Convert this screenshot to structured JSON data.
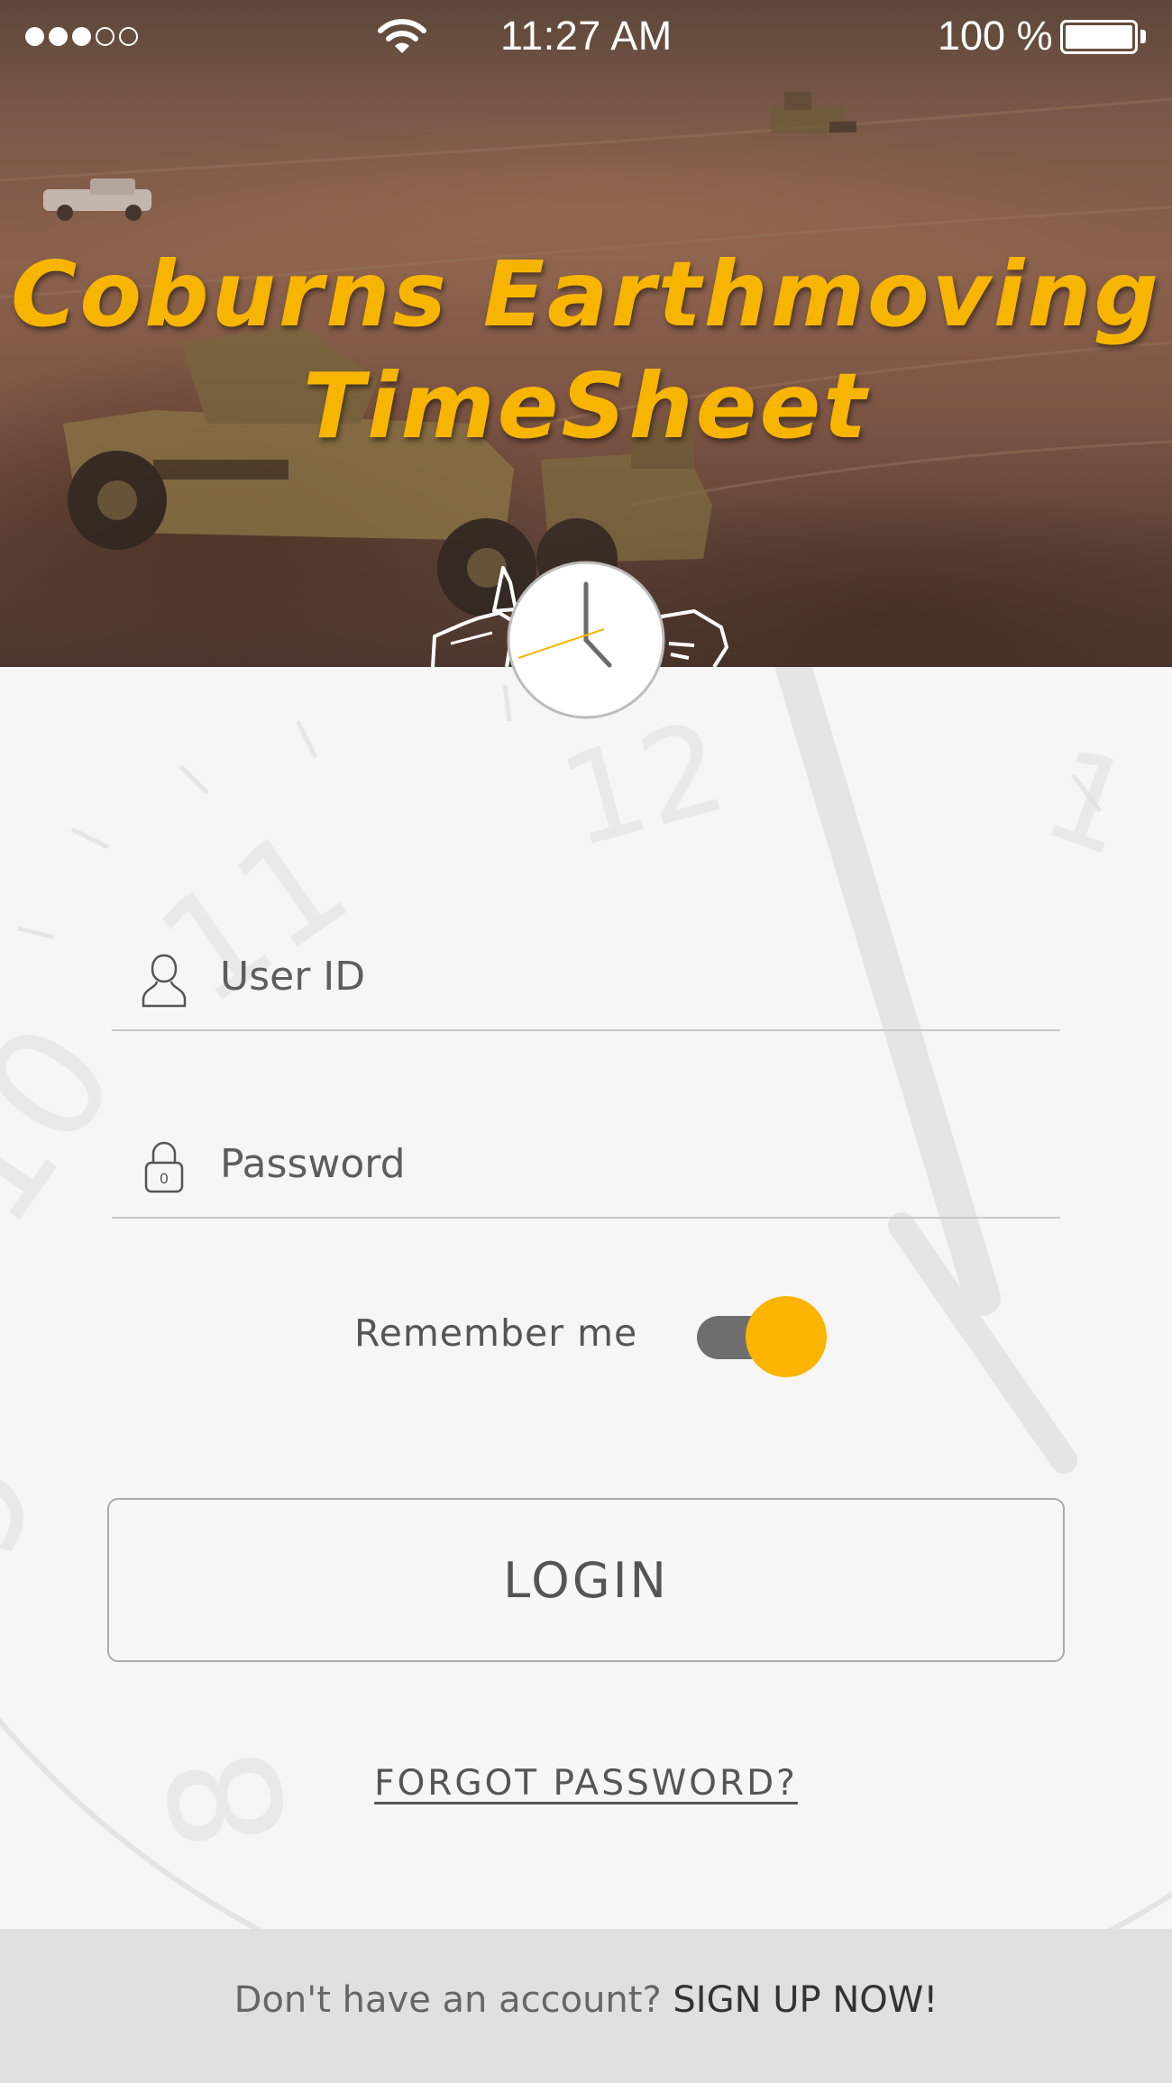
{
  "status_bar": {
    "signal_bars": [
      true,
      true,
      true,
      false,
      false
    ],
    "time": "11:27 AM",
    "battery_percent": "100 %",
    "battery_level": 1.0
  },
  "app": {
    "title_line1": "Coburns Earthmoving",
    "title_line2": "TimeSheet",
    "accent_color": "#f7b500",
    "logo_icon": "clock-and-paper-icon"
  },
  "login_form": {
    "user_id": {
      "icon": "user-icon",
      "placeholder": "User ID",
      "value": ""
    },
    "password": {
      "icon": "padlock-icon",
      "placeholder": "Password",
      "value": ""
    },
    "remember_me": {
      "label": "Remember me",
      "on": true
    },
    "login_button": "LOGIN",
    "forgot_password": "FORGOT PASSWORD?"
  },
  "footer": {
    "question": "Don't have an account?",
    "signup_link": "SIGN UP NOW!"
  }
}
